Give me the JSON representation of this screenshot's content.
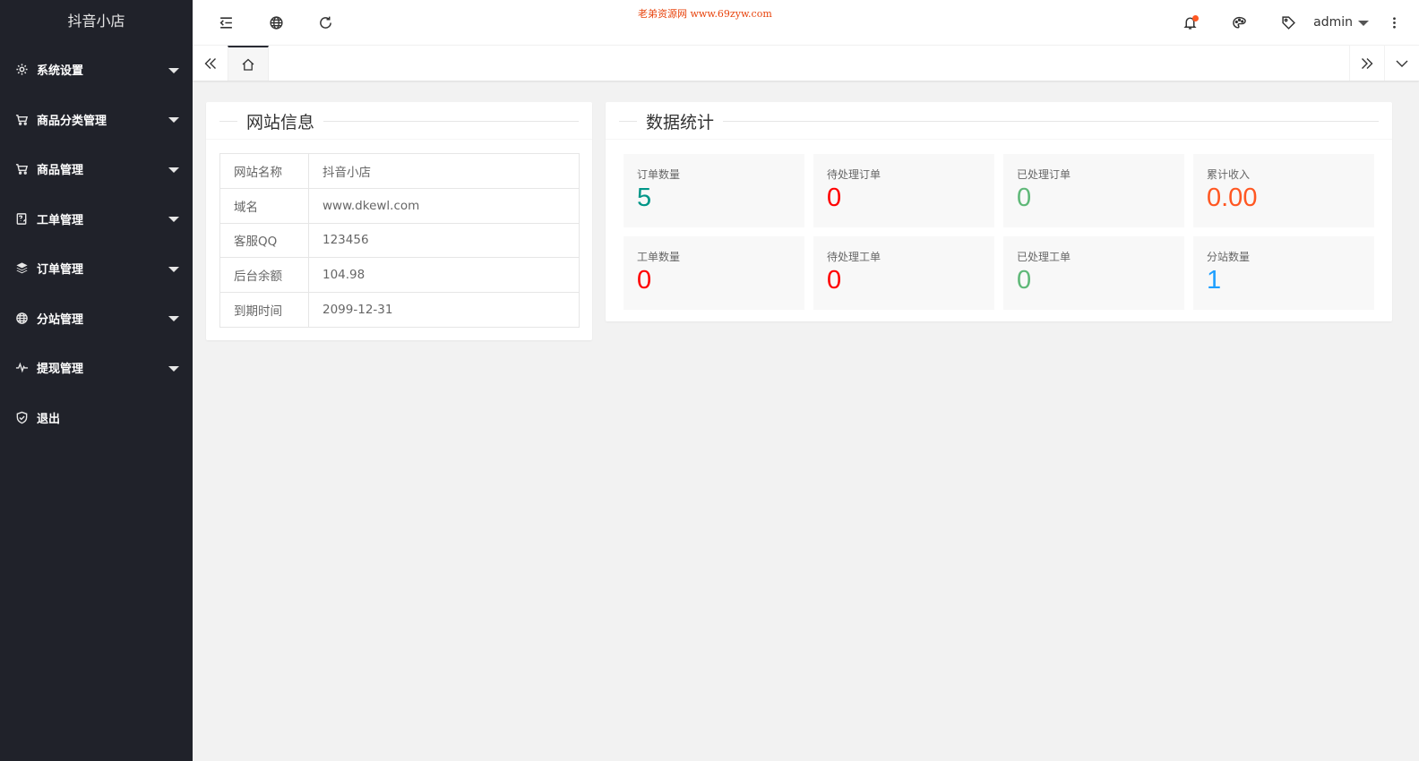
{
  "app": {
    "title": "抖音小店"
  },
  "sidebar": {
    "items": [
      {
        "label": "系统设置",
        "icon": "gear-icon",
        "has_arrow": true
      },
      {
        "label": "商品分类管理",
        "icon": "cart-icon",
        "has_arrow": true
      },
      {
        "label": "商品管理",
        "icon": "cart-icon",
        "has_arrow": true
      },
      {
        "label": "工单管理",
        "icon": "ticket-icon",
        "has_arrow": true
      },
      {
        "label": "订单管理",
        "icon": "layers-icon",
        "has_arrow": true
      },
      {
        "label": "分站管理",
        "icon": "globe-icon",
        "has_arrow": true
      },
      {
        "label": "提现管理",
        "icon": "pulse-icon",
        "has_arrow": true
      },
      {
        "label": "退出",
        "icon": "shield-icon",
        "has_arrow": false
      }
    ]
  },
  "header": {
    "watermark": "老弟资源网 www.69zyw.com",
    "user": "admin"
  },
  "site_info": {
    "title": "网站信息",
    "rows": [
      {
        "key": "网站名称",
        "value": "抖音小店"
      },
      {
        "key": "域名",
        "value": "www.dkewl.com"
      },
      {
        "key": "客服QQ",
        "value": "123456"
      },
      {
        "key": "后台余额",
        "value": "104.98"
      },
      {
        "key": "到期时间",
        "value": "2099-12-31"
      }
    ]
  },
  "stats": {
    "title": "数据统计",
    "items": [
      {
        "label": "订单数量",
        "value": "5",
        "color": "#009688"
      },
      {
        "label": "待处理订单",
        "value": "0",
        "color": "#ff0000"
      },
      {
        "label": "已处理订单",
        "value": "0",
        "color": "#5fb878"
      },
      {
        "label": "累计收入",
        "value": "0.00",
        "color": "#ff5722"
      },
      {
        "label": "工单数量",
        "value": "0",
        "color": "#ff0000"
      },
      {
        "label": "待处理工单",
        "value": "0",
        "color": "#ff0000"
      },
      {
        "label": "已处理工单",
        "value": "0",
        "color": "#5fb878"
      },
      {
        "label": "分站数量",
        "value": "1",
        "color": "#1e9fff"
      }
    ]
  }
}
